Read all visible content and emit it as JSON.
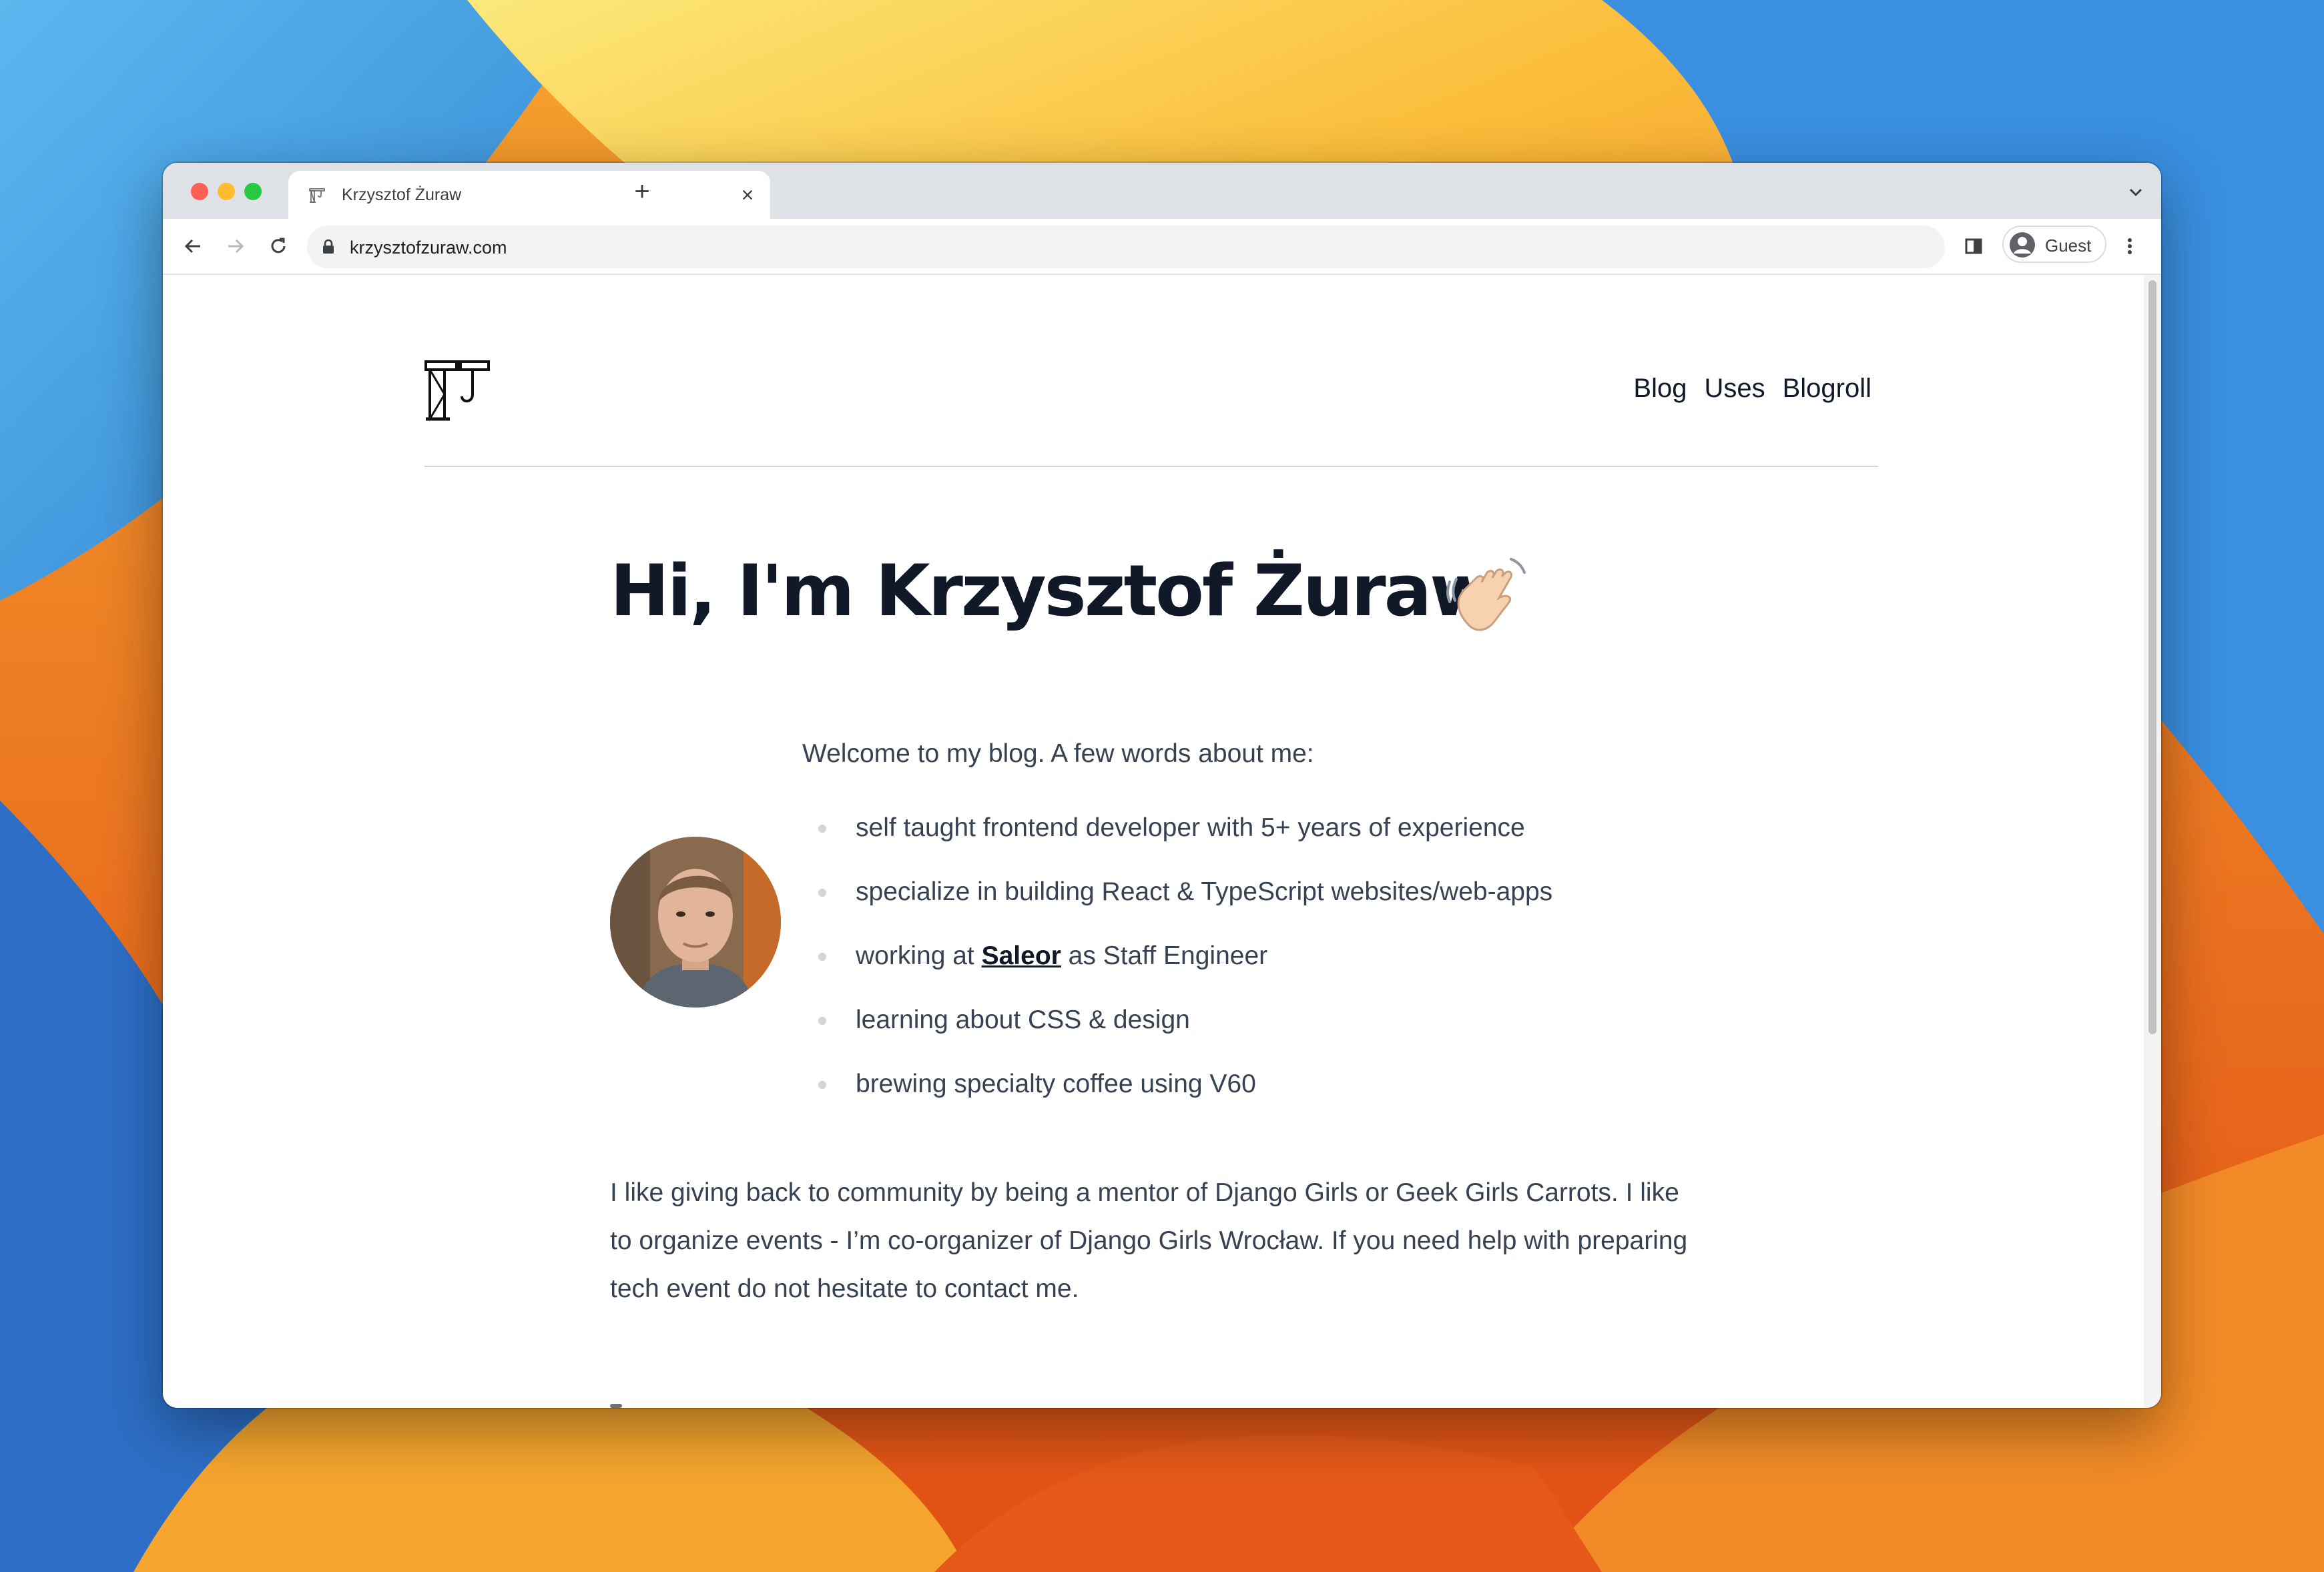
{
  "browser": {
    "tab_title": "Krzysztof Żuraw",
    "new_tab_symbol": "+",
    "close_symbol": "×",
    "url": "krzysztofzuraw.com",
    "profile_label": "Guest"
  },
  "site": {
    "nav": [
      "Blog",
      "Uses",
      "Blogroll"
    ],
    "hero_title": "Hi, I'm Krzysztof Żuraw",
    "intro": "Welcome to my blog. A few words about me:",
    "facts": [
      {
        "text": "self taught frontend developer with 5+ years of experience"
      },
      {
        "text": "specialize in building React & TypeScript websites/web-apps"
      },
      {
        "before": "working at ",
        "link": "Saleor",
        "after": " as Staff Engineer"
      },
      {
        "text": "learning about CSS & design"
      },
      {
        "text": "brewing specialty coffee using V60"
      }
    ],
    "paragraph": "I like giving back to community by being a mentor of Django Girls or Geek Girls Carrots. I like to organize events - I’m co-organizer of Django Girls Wrocław. If you need help with preparing tech event do not hesitate to contact me."
  },
  "colors": {
    "accent_text": "#111827",
    "body_text": "#374151",
    "tabstrip": "#dee1e6"
  }
}
